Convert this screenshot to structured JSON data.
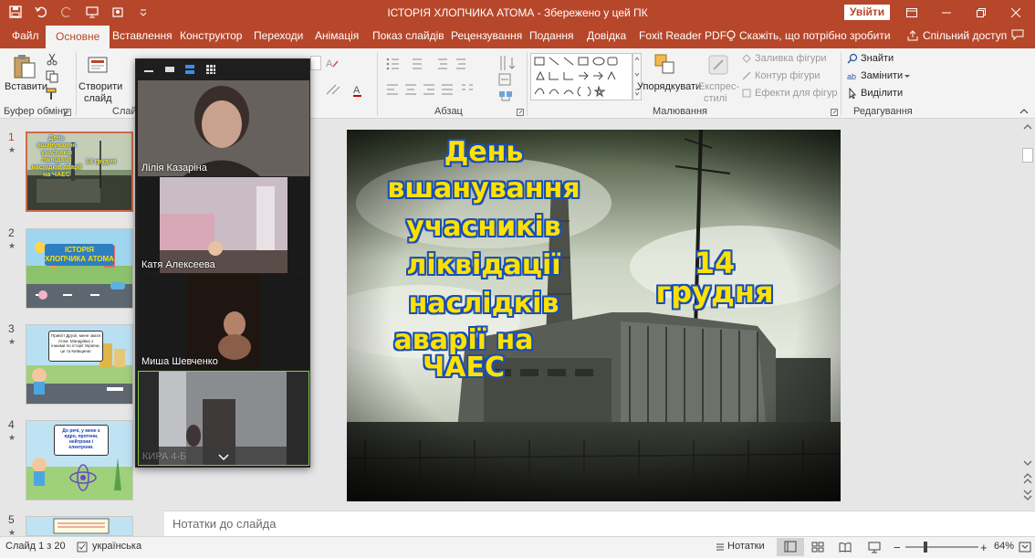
{
  "titlebar": {
    "title": "ІСТОРІЯ ХЛОПЧИКА АТОМА  -  Збережено у цей ПК",
    "signin": "Увійти"
  },
  "tabs": [
    {
      "label": "Файл"
    },
    {
      "label": "Основне"
    },
    {
      "label": "Вставлення"
    },
    {
      "label": "Конструктор"
    },
    {
      "label": "Переходи"
    },
    {
      "label": "Анімація"
    },
    {
      "label": "Показ слайдів"
    },
    {
      "label": "Рецензування"
    },
    {
      "label": "Подання"
    },
    {
      "label": "Довідка"
    },
    {
      "label": "Foxit Reader PDF"
    },
    {
      "label": "Скажіть, що потрібно зробити"
    },
    {
      "label": "Спільний доступ"
    }
  ],
  "ribbon": {
    "paste": "Вставити",
    "new_slide_1": "Створити",
    "new_slide_2": "слайд",
    "clipboard": "Буфер обміну",
    "slides": "Слайди",
    "paragraph": "Абзац",
    "arrange": "Упорядкувати",
    "quick_styles_1": "Експрес-",
    "quick_styles_2": "стилі",
    "shape_fill": "Заливка фігури",
    "shape_outline": "Контур фігури",
    "shape_effects": "Ефекти для фігур",
    "drawing": "Малювання",
    "find": "Знайти",
    "replace": "Замінити",
    "select": "Виділити",
    "editing": "Редагування"
  },
  "thumbnails": [
    {
      "num": "1",
      "star": "★",
      "title": "День вшанування учасників ліквідації наслідків аварії на ЧАЕС",
      "date": "14 грудня"
    },
    {
      "num": "2",
      "star": "★",
      "title": "ІСТОРІЯ ХЛОПЧИКА АТОМА"
    },
    {
      "num": "3",
      "star": "★",
      "text": "Привіт! Друзі!, мене звати Атом. Мандрівка з іншими по історії України, це та Київщина!"
    },
    {
      "num": "4",
      "star": "★",
      "text": "До речі, у мене є ядро, протони, нейтрони і електрони."
    },
    {
      "num": "5",
      "star": "★"
    }
  ],
  "slide": {
    "title_lines": [
      "День",
      "вшанування",
      "учасників",
      "ліквідації",
      "наслідків",
      "аварії на ЧАЕС"
    ],
    "date": "14 грудня"
  },
  "notes": {
    "placeholder": "Нотатки до слайда"
  },
  "statusbar": {
    "slide_info": "Слайд 1 з 20",
    "language": "українська",
    "notes": "Нотатки",
    "zoom": "64%"
  },
  "zoom_participants": [
    {
      "name": "Лілія Казаріна"
    },
    {
      "name": "Катя Алексеева"
    },
    {
      "name": "Миша Шевченко"
    },
    {
      "name": "КИРА 4-Б"
    }
  ],
  "colors": {
    "accent": "#b7472a",
    "slide_title": "#ffe100",
    "slide_title_outline": "#1a4fb5"
  }
}
